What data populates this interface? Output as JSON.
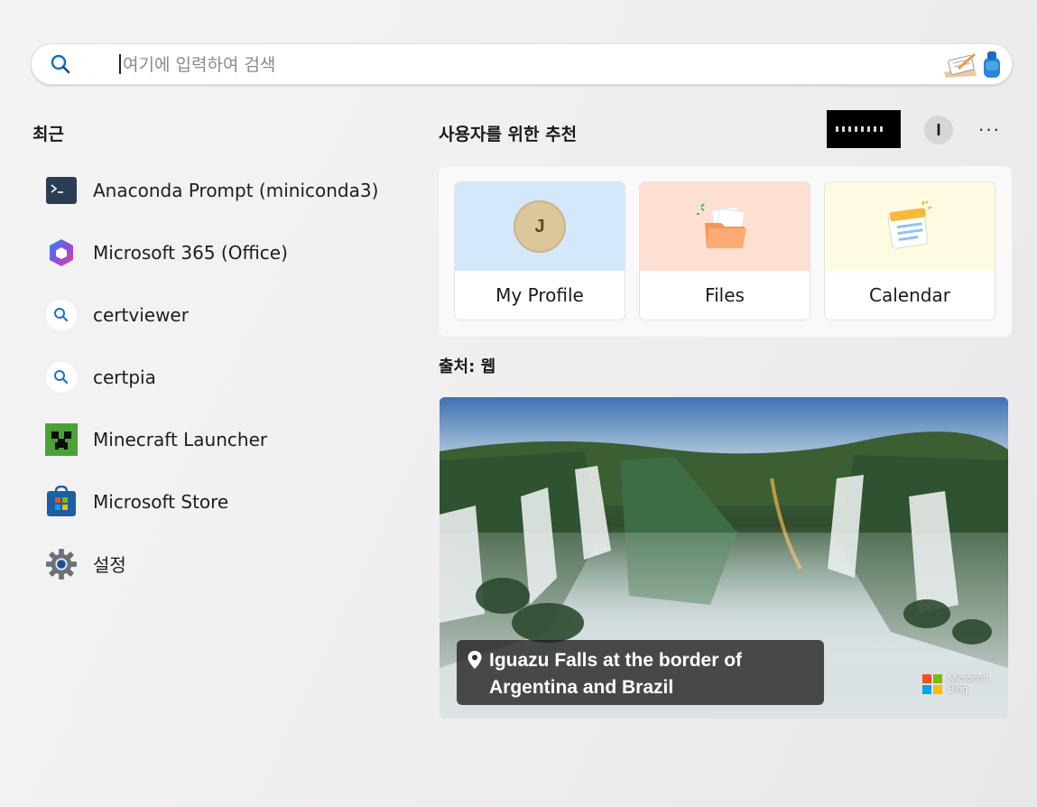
{
  "search": {
    "placeholder": "여기에 입력하여 검색"
  },
  "recent": {
    "title": "최근",
    "items": [
      {
        "label": "Anaconda Prompt (miniconda3)",
        "icon": "terminal-icon"
      },
      {
        "label": "Microsoft 365 (Office)",
        "icon": "microsoft-365-icon"
      },
      {
        "label": "certviewer",
        "icon": "search-icon"
      },
      {
        "label": "certpia",
        "icon": "search-icon"
      },
      {
        "label": "Minecraft Launcher",
        "icon": "minecraft-icon"
      },
      {
        "label": "Microsoft Store",
        "icon": "store-icon"
      },
      {
        "label": "설정",
        "icon": "gear-icon"
      }
    ]
  },
  "recommended": {
    "title": "사용자를 위한 추천",
    "avatar_letter": "I",
    "more": "···",
    "tiles": [
      {
        "label": "My Profile",
        "avatar_letter": "J",
        "color": "#d4e8fb"
      },
      {
        "label": "Files",
        "color": "#fde0d2"
      },
      {
        "label": "Calendar",
        "color": "#fffbe0"
      }
    ]
  },
  "web": {
    "source_label": "출처: 웹",
    "caption": "Iguazu Falls at the border of Argentina and Brazil",
    "bing_line1": "Microsoft",
    "bing_line2": "Bing"
  },
  "colors": {
    "accent": "#0f6cbd",
    "bing_red": "#f25022",
    "bing_green": "#7fba00",
    "bing_blue": "#00a4ef",
    "bing_yellow": "#ffb900"
  }
}
